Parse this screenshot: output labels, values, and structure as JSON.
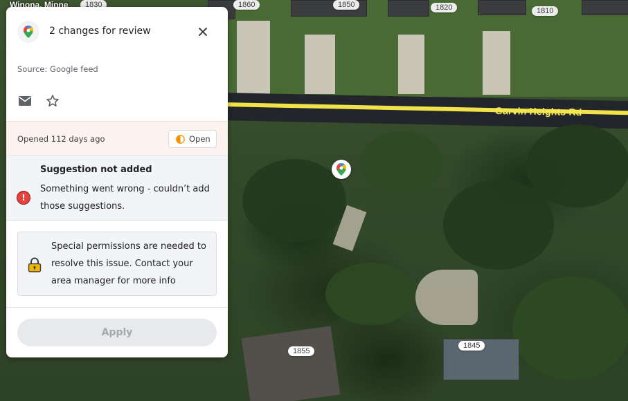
{
  "map": {
    "city_label": "Winona, Minne",
    "road_name": "Garvin Heights Rd",
    "house_numbers_top": [
      "1830",
      "1860",
      "1850",
      "1820",
      "1810"
    ],
    "house_numbers_bottom": [
      "1855",
      "1845"
    ],
    "pin_icon": "google-maps-pin-icon"
  },
  "panel": {
    "title": "2 changes for review",
    "source": "Source: Google feed",
    "icons": {
      "logo": "google-maps-logo-icon",
      "close": "close-icon",
      "mail": "mail-icon",
      "star": "star-icon"
    },
    "status": {
      "opened_text": "Opened 112 days ago",
      "state_label": "Open"
    },
    "error": {
      "title": "Suggestion not added",
      "message": "Something went wrong - couldn’t add those suggestions."
    },
    "permissions_message": "Special permissions are needed to resolve this issue. Contact your area manager for more info",
    "apply_label": "Apply"
  },
  "colors": {
    "error_red": "#e94040",
    "road_yellow": "#f2e24a",
    "status_orange": "#f29200",
    "lock_yellow": "#f4b400"
  }
}
